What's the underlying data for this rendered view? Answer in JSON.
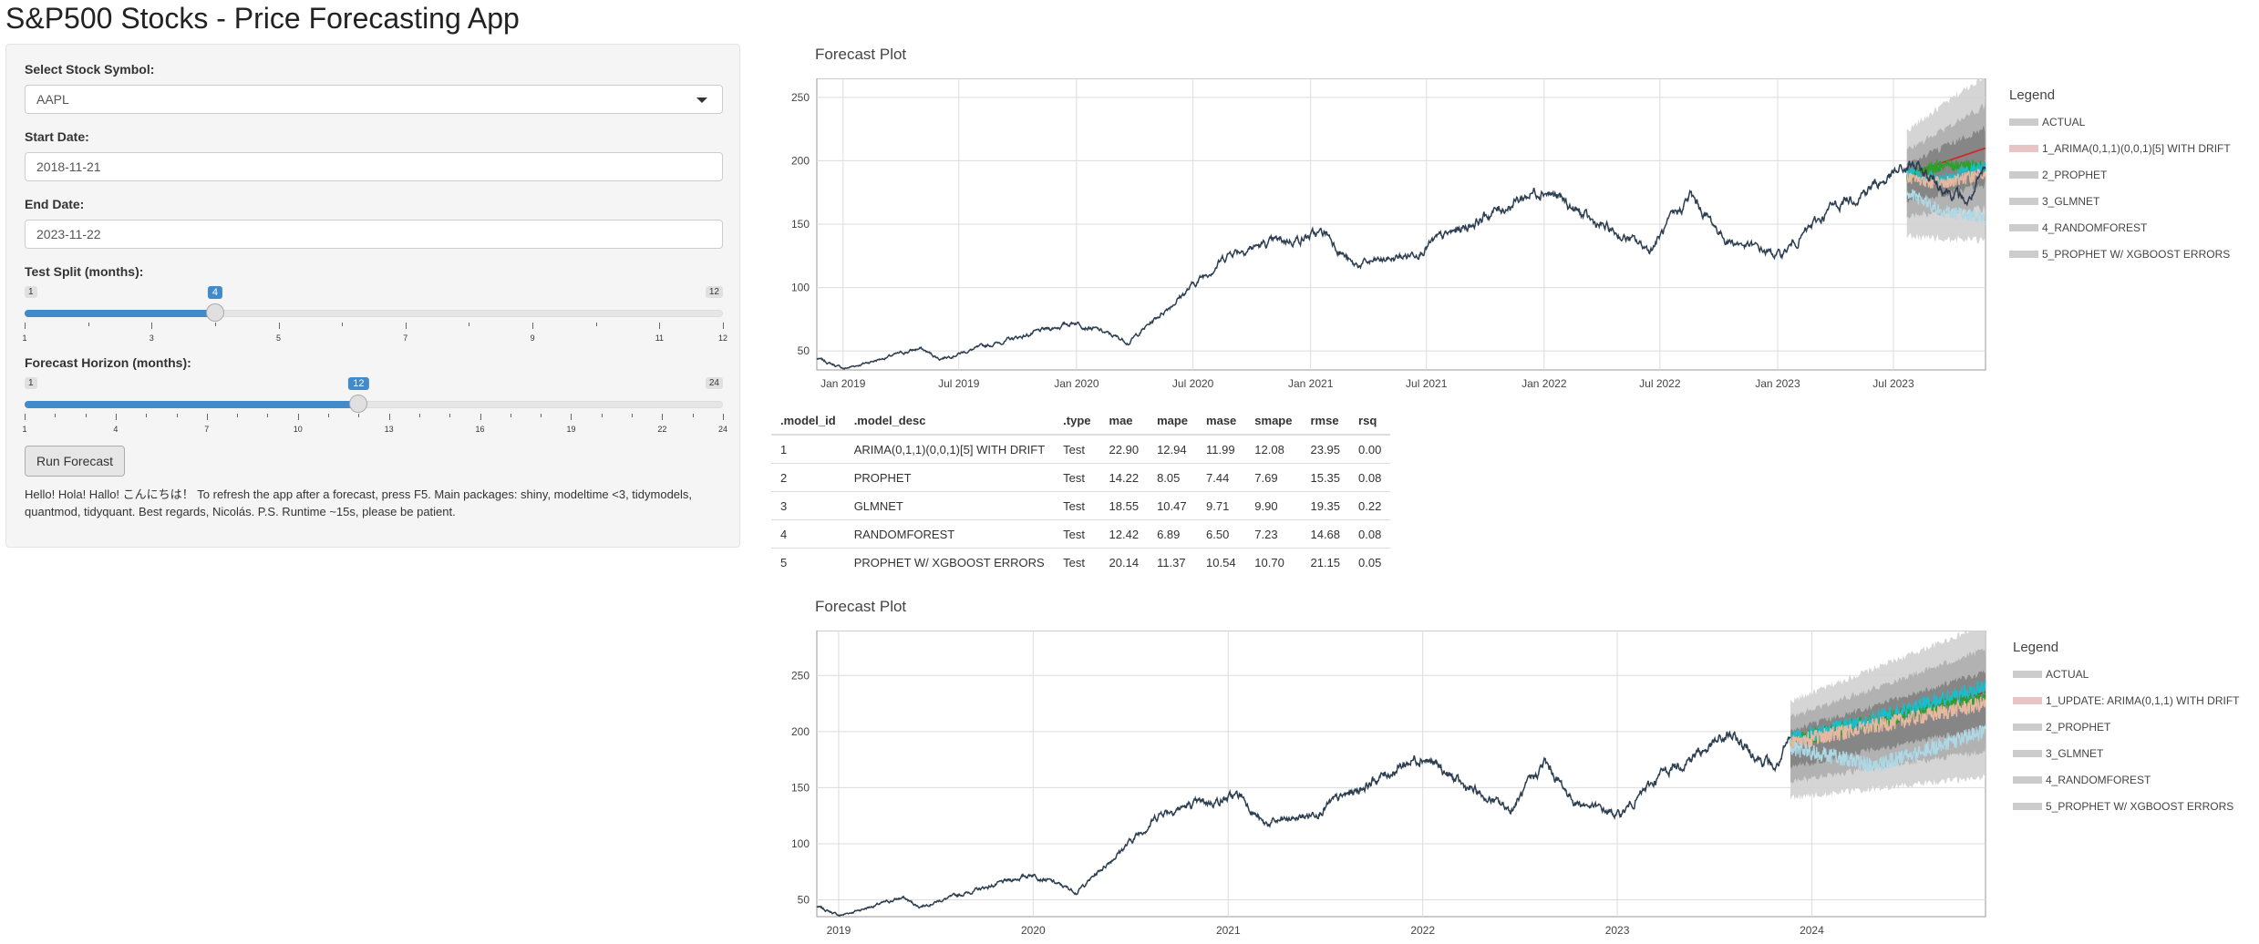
{
  "app": {
    "title": "S&P500 Stocks - Price Forecasting App"
  },
  "sidebar": {
    "symbol_label": "Select Stock Symbol:",
    "symbol_value": "AAPL",
    "start_label": "Start Date:",
    "start_value": "2018-11-21",
    "end_label": "End Date:",
    "end_value": "2023-11-22",
    "test_split": {
      "label": "Test Split (months):",
      "min": "1",
      "max": "12",
      "value": 4,
      "ticks": [
        "1",
        "3",
        "5",
        "7",
        "9",
        "11",
        "12"
      ]
    },
    "horizon": {
      "label": "Forecast Horizon (months):",
      "min": "1",
      "max": "24",
      "value": 12,
      "ticks": [
        "1",
        "4",
        "7",
        "10",
        "13",
        "16",
        "19",
        "22",
        "24"
      ]
    },
    "run_label": "Run Forecast",
    "note": "Hello! Hola! Hallo! こんにちは！ To refresh the app after a forecast, press F5. Main packages: shiny, modeltime <3, tidymodels, quantmod, tidyquant. Best regards, Nicolás. P.S. Runtime ~15s, please be patient."
  },
  "plot1": {
    "title": "Forecast Plot",
    "legend_title": "Legend",
    "legend": [
      {
        "label": "ACTUAL",
        "color": "#cccccc"
      },
      {
        "label": "1_ARIMA(0,1,1)(0,0,1)[5] WITH DRIFT",
        "color": "#e8c4c4"
      },
      {
        "label": "2_PROPHET",
        "color": "#cccccc"
      },
      {
        "label": "3_GLMNET",
        "color": "#cccccc"
      },
      {
        "label": "4_RANDOMFOREST",
        "color": "#cccccc"
      },
      {
        "label": "5_PROPHET W/ XGBOOST ERRORS",
        "color": "#cccccc"
      }
    ],
    "x_ticks": [
      "Jan 2019",
      "Jul 2019",
      "Jan 2020",
      "Jul 2020",
      "Jan 2021",
      "Jul 2021",
      "Jan 2022",
      "Jul 2022",
      "Jan 2023",
      "Jul 2023"
    ],
    "y_ticks": [
      "50",
      "100",
      "150",
      "200",
      "250"
    ]
  },
  "plot2": {
    "title": "Forecast Plot",
    "legend_title": "Legend",
    "legend": [
      {
        "label": "ACTUAL",
        "color": "#cccccc"
      },
      {
        "label": "1_UPDATE: ARIMA(0,1,1) WITH DRIFT",
        "color": "#e8c4c4"
      },
      {
        "label": "2_PROPHET",
        "color": "#cccccc"
      },
      {
        "label": "3_GLMNET",
        "color": "#cccccc"
      },
      {
        "label": "4_RANDOMFOREST",
        "color": "#cccccc"
      },
      {
        "label": "5_PROPHET W/ XGBOOST ERRORS",
        "color": "#cccccc"
      }
    ],
    "x_ticks": [
      "2019",
      "2020",
      "2021",
      "2022",
      "2023",
      "2024"
    ],
    "y_ticks": [
      "50",
      "100",
      "150",
      "200",
      "250"
    ]
  },
  "metrics": {
    "headers": [
      ".model_id",
      ".model_desc",
      ".type",
      "mae",
      "mape",
      "mase",
      "smape",
      "rmse",
      "rsq"
    ],
    "rows": [
      [
        "1",
        "ARIMA(0,1,1)(0,0,1)[5] WITH DRIFT",
        "Test",
        "22.90",
        "12.94",
        "11.99",
        "12.08",
        "23.95",
        "0.00"
      ],
      [
        "2",
        "PROPHET",
        "Test",
        "14.22",
        "8.05",
        "7.44",
        "7.69",
        "15.35",
        "0.08"
      ],
      [
        "3",
        "GLMNET",
        "Test",
        "18.55",
        "10.47",
        "9.71",
        "9.90",
        "19.35",
        "0.22"
      ],
      [
        "4",
        "RANDOMFOREST",
        "Test",
        "12.42",
        "6.89",
        "6.50",
        "7.23",
        "14.68",
        "0.08"
      ],
      [
        "5",
        "PROPHET W/ XGBOOST ERRORS",
        "Test",
        "20.14",
        "11.37",
        "10.54",
        "10.70",
        "21.15",
        "0.05"
      ]
    ]
  },
  "chart_data": [
    {
      "type": "line",
      "title": "Forecast Plot",
      "xlabel": "",
      "ylabel": "",
      "x_range": [
        "2018-11-21",
        "2023-11-22"
      ],
      "ylim": [
        35,
        265
      ],
      "grid": true,
      "legend_position": "right",
      "series": [
        {
          "name": "ACTUAL",
          "color": "#2c3e50",
          "x": [
            "2018-11-21",
            "2019-01-03",
            "2019-05-01",
            "2019-06-01",
            "2019-12-31",
            "2020-03-23",
            "2020-08-31",
            "2021-01-26",
            "2021-03-08",
            "2021-06-01",
            "2021-12-30",
            "2022-03-15",
            "2022-06-16",
            "2022-08-17",
            "2022-10-12",
            "2023-01-05",
            "2023-04-01",
            "2023-07-31",
            "2023-10-26",
            "2023-11-22"
          ],
          "y": [
            44,
            36,
            52,
            44,
            73,
            57,
            129,
            143,
            117,
            125,
            179,
            152,
            130,
            172,
            138,
            125,
            165,
            196,
            167,
            191
          ]
        },
        {
          "name": "1_ARIMA(0,1,1)(0,0,1)[5] WITH DRIFT",
          "color": "#d62728",
          "x": [
            "2023-07-22",
            "2023-11-22"
          ],
          "y": [
            189,
            210
          ]
        },
        {
          "name": "2_PROPHET",
          "color": "#2ca02c",
          "x": [
            "2023-07-22",
            "2023-09-15",
            "2023-11-22"
          ],
          "y": [
            188,
            197,
            195
          ]
        },
        {
          "name": "3_GLMNET",
          "color": "#17becf",
          "x": [
            "2023-07-22",
            "2023-09-15",
            "2023-11-22"
          ],
          "y": [
            190,
            185,
            196
          ]
        },
        {
          "name": "4_RANDOMFOREST",
          "color": "#e6b8a0",
          "x": [
            "2023-07-22",
            "2023-09-15",
            "2023-11-22"
          ],
          "y": [
            187,
            182,
            190
          ]
        },
        {
          "name": "5_PROPHET W/ XGBOOST ERRORS",
          "color": "#add8e6",
          "x": [
            "2023-07-22",
            "2023-09-15",
            "2023-11-22"
          ],
          "y": [
            175,
            160,
            155
          ]
        }
      ]
    },
    {
      "type": "line",
      "title": "Forecast Plot",
      "xlabel": "",
      "ylabel": "",
      "x_range": [
        "2018-11-21",
        "2024-11-22"
      ],
      "ylim": [
        35,
        290
      ],
      "grid": true,
      "legend_position": "right",
      "series": [
        {
          "name": "ACTUAL",
          "color": "#2c3e50",
          "x": [
            "2018-11-21",
            "2019-01-03",
            "2019-05-01",
            "2019-06-01",
            "2019-12-31",
            "2020-03-23",
            "2020-08-31",
            "2021-01-26",
            "2021-03-08",
            "2021-06-01",
            "2021-12-30",
            "2022-03-15",
            "2022-06-16",
            "2022-08-17",
            "2022-10-12",
            "2023-01-05",
            "2023-04-01",
            "2023-07-31",
            "2023-10-26",
            "2023-11-22"
          ],
          "y": [
            44,
            36,
            52,
            44,
            73,
            57,
            129,
            143,
            117,
            125,
            179,
            152,
            130,
            172,
            138,
            125,
            165,
            196,
            167,
            191
          ]
        },
        {
          "name": "1_UPDATE: ARIMA(0,1,1) WITH DRIFT",
          "color": "#d62728",
          "x": [
            "2023-11-22",
            "2024-11-22"
          ],
          "y": [
            191,
            235
          ]
        },
        {
          "name": "2_PROPHET",
          "color": "#2ca02c",
          "x": [
            "2023-11-22",
            "2024-05-01",
            "2024-11-22"
          ],
          "y": [
            192,
            210,
            232
          ]
        },
        {
          "name": "3_GLMNET",
          "color": "#17becf",
          "x": [
            "2023-11-22",
            "2024-05-01",
            "2024-11-22"
          ],
          "y": [
            193,
            212,
            240
          ]
        },
        {
          "name": "4_RANDOMFOREST",
          "color": "#e6b8a0",
          "x": [
            "2023-11-22",
            "2024-05-01",
            "2024-11-22"
          ],
          "y": [
            190,
            205,
            225
          ]
        },
        {
          "name": "5_PROPHET W/ XGBOOST ERRORS",
          "color": "#add8e6",
          "x": [
            "2023-11-22",
            "2024-05-01",
            "2024-11-22"
          ],
          "y": [
            185,
            170,
            200
          ]
        }
      ]
    }
  ]
}
